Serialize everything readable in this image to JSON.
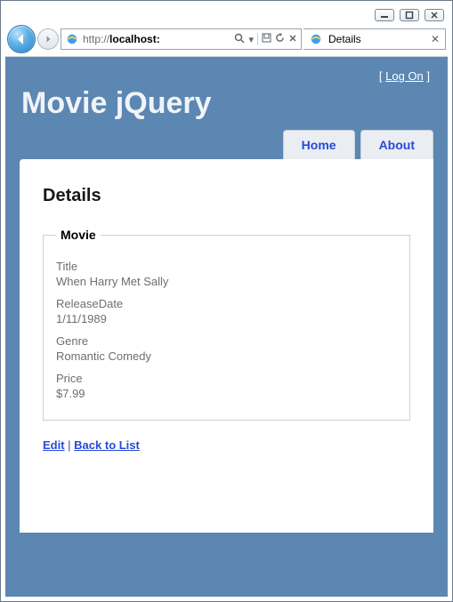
{
  "window": {
    "address_proto": "http://",
    "address_host": "localhost:",
    "tab_title": "Details"
  },
  "login": {
    "left_bracket": "[ ",
    "log_on": "Log On",
    "right_bracket": " ]"
  },
  "site_title": "Movie jQuery",
  "nav": {
    "home": "Home",
    "about": "About"
  },
  "content": {
    "heading": "Details",
    "legend": "Movie",
    "fields": {
      "title_label": "Title",
      "title_value": "When Harry Met Sally",
      "release_label": "ReleaseDate",
      "release_value": "1/11/1989",
      "genre_label": "Genre",
      "genre_value": "Romantic Comedy",
      "price_label": "Price",
      "price_value": "$7.99"
    },
    "edit": "Edit",
    "sep": " | ",
    "back": "Back to List"
  }
}
